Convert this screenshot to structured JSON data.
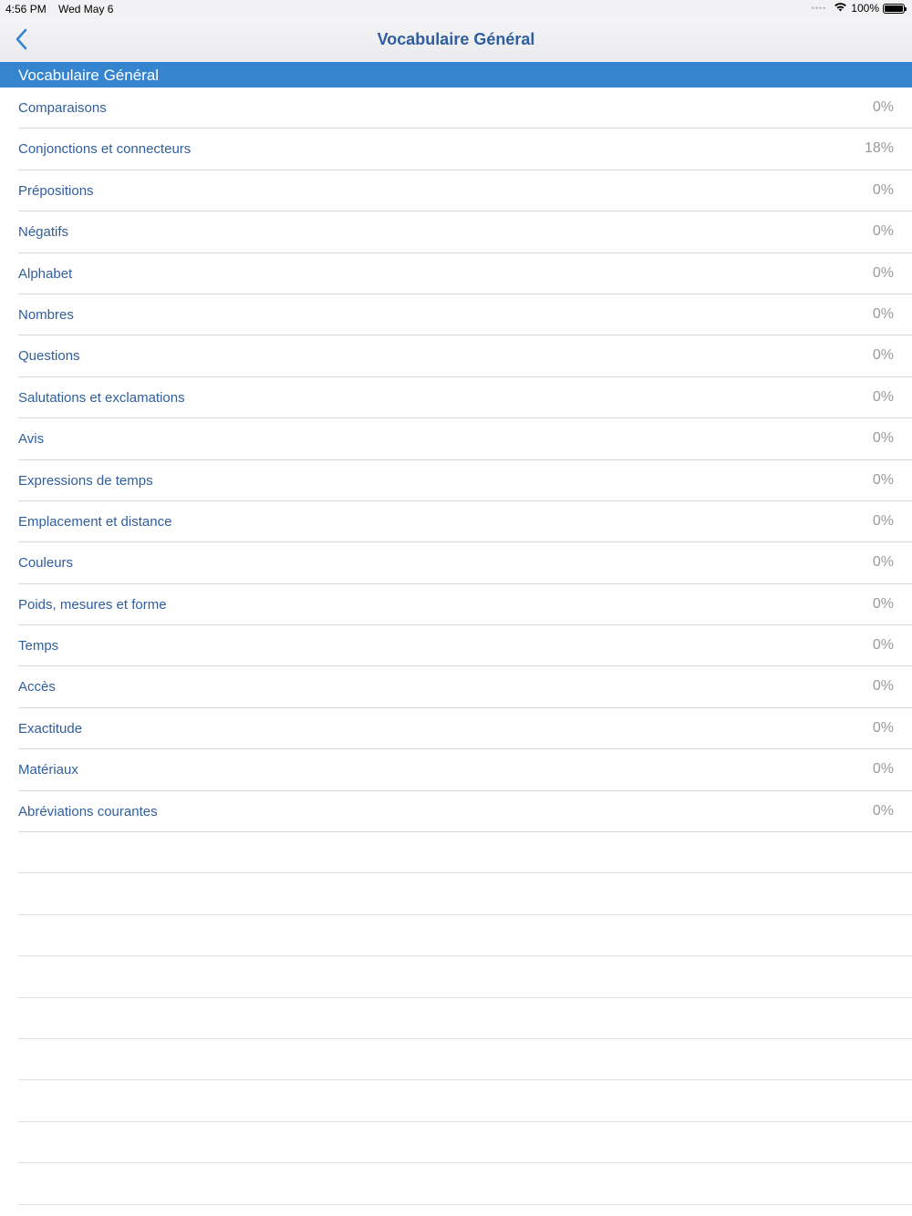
{
  "status_bar": {
    "time": "4:56 PM",
    "date": "Wed May 6",
    "battery_text": "100%",
    "icons": [
      "signal-dots-icon",
      "wifi-icon",
      "battery-icon"
    ]
  },
  "nav": {
    "title": "Vocabulaire Général",
    "back_icon": "chevron-left-icon"
  },
  "section": {
    "title": "Vocabulaire Général"
  },
  "items": [
    {
      "label": "Comparaisons",
      "value": "0%"
    },
    {
      "label": "Conjonctions et connecteurs",
      "value": "18%"
    },
    {
      "label": "Prépositions",
      "value": "0%"
    },
    {
      "label": "Négatifs",
      "value": "0%"
    },
    {
      "label": "Alphabet",
      "value": "0%"
    },
    {
      "label": "Nombres",
      "value": "0%"
    },
    {
      "label": "Questions",
      "value": "0%"
    },
    {
      "label": "Salutations et exclamations",
      "value": "0%"
    },
    {
      "label": "Avis",
      "value": "0%"
    },
    {
      "label": "Expressions de temps",
      "value": "0%"
    },
    {
      "label": "Emplacement et distance",
      "value": "0%"
    },
    {
      "label": "Couleurs",
      "value": "0%"
    },
    {
      "label": "Poids, mesures et forme",
      "value": "0%"
    },
    {
      "label": "Temps",
      "value": "0%"
    },
    {
      "label": "Accès",
      "value": "0%"
    },
    {
      "label": "Exactitude",
      "value": "0%"
    },
    {
      "label": "Matériaux",
      "value": "0%"
    },
    {
      "label": "Abréviations courantes",
      "value": "0%"
    }
  ],
  "colors": {
    "accent": "#3584d0",
    "title_text": "#2f5e9e",
    "value_text": "#9a9a9e"
  }
}
